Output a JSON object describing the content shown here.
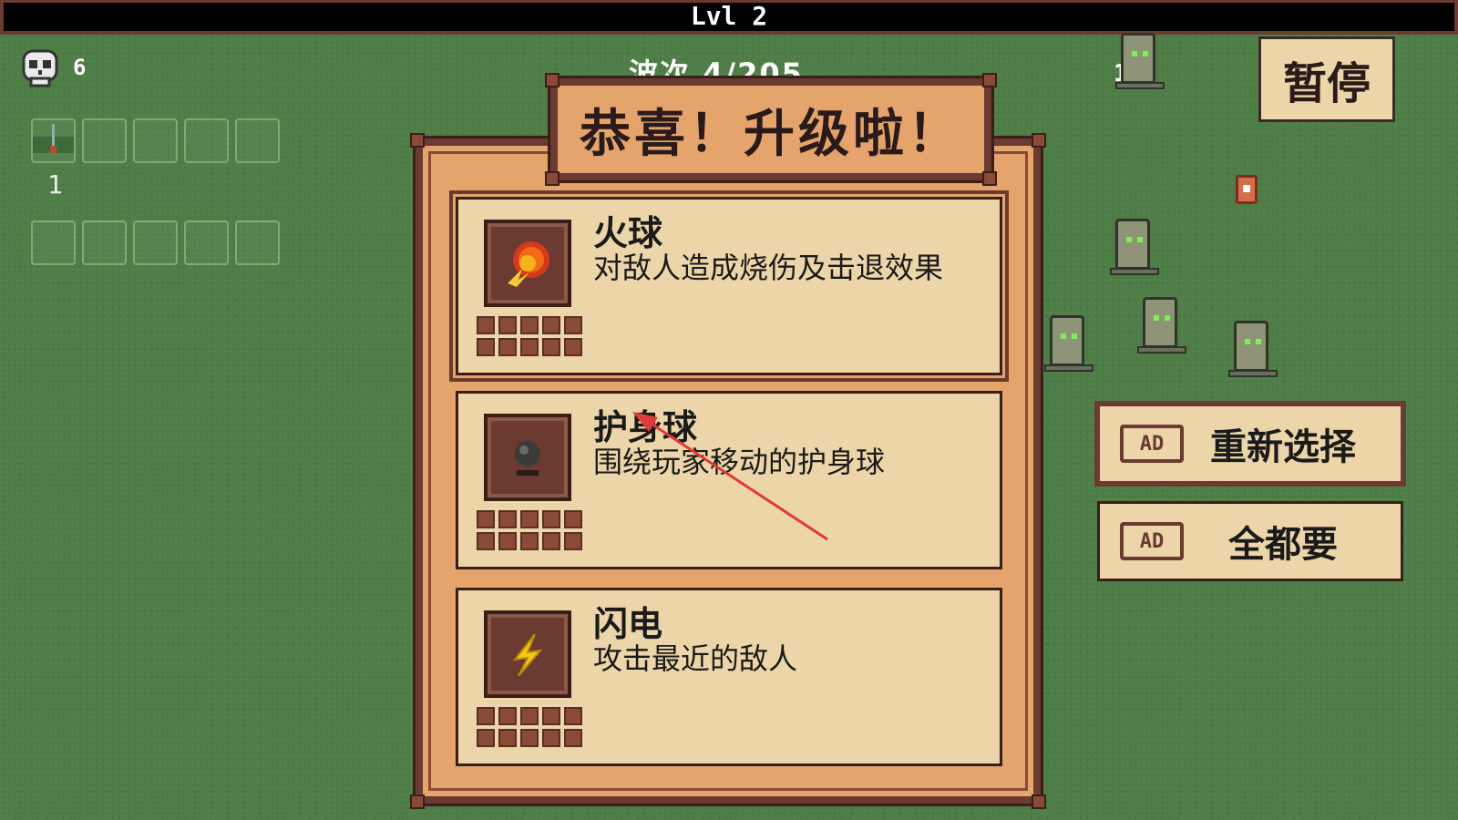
{
  "hud": {
    "level_label": "Lvl 2",
    "kill_count": "6",
    "slot_count": "1",
    "wave_text": "波次 4/205",
    "coin_count": "1"
  },
  "pause_button": {
    "label": "暂停"
  },
  "levelup": {
    "title": "恭喜！升级啦！",
    "options": [
      {
        "name": "火球",
        "description": "对敌人造成烧伤及击退效果",
        "icon": "fireball-icon"
      },
      {
        "name": "护身球",
        "description": "围绕玩家移动的护身球",
        "icon": "orb-icon"
      },
      {
        "name": "闪电",
        "description": "攻击最近的敌人",
        "icon": "lightning-icon"
      }
    ]
  },
  "side_buttons": {
    "reroll": {
      "ad_label": "AD",
      "label": "重新选择"
    },
    "take_all": {
      "ad_label": "AD",
      "label": "全都要"
    }
  },
  "colors": {
    "grass": "#4f7d46",
    "panel": "#e5a46c",
    "card": "#ecd5a8",
    "frame": "#6b3a30",
    "annotation": "#e03a3a"
  }
}
